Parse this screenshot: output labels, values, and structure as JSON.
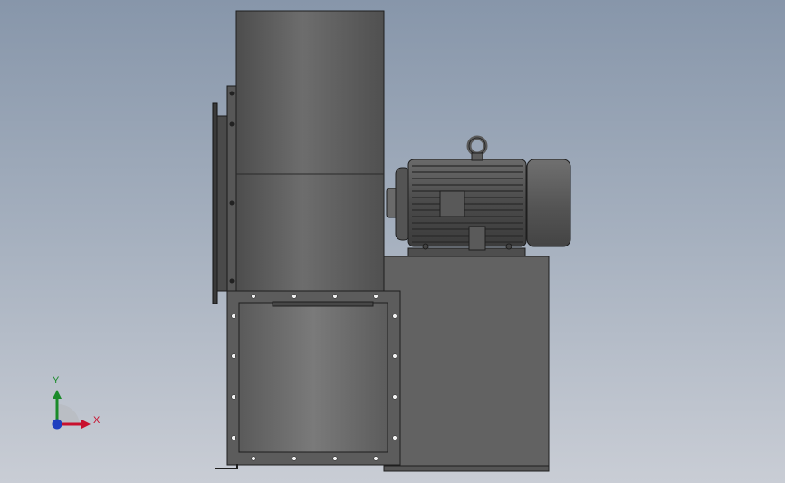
{
  "scene": {
    "model": "centrifugal-fan-with-motor",
    "view": "front"
  },
  "triad": {
    "x_label": "X",
    "y_label": "Y",
    "x_color": "#c8102e",
    "y_color": "#1a8a2a",
    "z_color": "#1f3fbf"
  },
  "colors": {
    "background_top": "#8796aa",
    "background_bottom": "#c9cdd5",
    "body": "#5f5f5f",
    "edge": "#1e1e1e"
  }
}
